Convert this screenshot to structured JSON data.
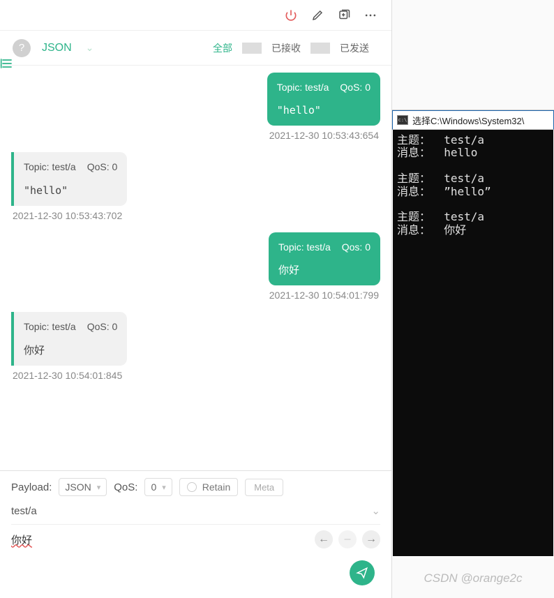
{
  "toolbar": {
    "format": "JSON",
    "filters": {
      "all": "全部",
      "received": "已接收",
      "sent": "已发送"
    }
  },
  "messages": [
    {
      "dir": "sent",
      "topic_lbl": "Topic:",
      "topic": "test/a",
      "qos_lbl": "QoS:",
      "qos": "0",
      "body": "\"hello\"",
      "ts": "2021-12-30 10:53:43:654"
    },
    {
      "dir": "rcvd",
      "topic_lbl": "Topic:",
      "topic": "test/a",
      "qos_lbl": "QoS:",
      "qos": "0",
      "body": "\"hello\"",
      "ts": "2021-12-30 10:53:43:702"
    },
    {
      "dir": "sent",
      "topic_lbl": "Topic:",
      "topic": "test/a",
      "qos_lbl": "Qos:",
      "qos": "0",
      "body": "你好",
      "ts": "2021-12-30 10:54:01:799"
    },
    {
      "dir": "rcvd",
      "topic_lbl": "Topic:",
      "topic": "test/a",
      "qos_lbl": "QoS:",
      "qos": "0",
      "body": "你好",
      "ts": "2021-12-30 10:54:01:845"
    }
  ],
  "compose": {
    "payload_lbl": "Payload:",
    "payload_format": "JSON",
    "qos_lbl": "QoS:",
    "qos_val": "0",
    "retain_lbl": "Retain",
    "meta_lbl": "Meta",
    "topic": "test/a",
    "body": "你好"
  },
  "terminal": {
    "title": "选择C:\\Windows\\System32\\",
    "lines": "主题：  test/a\n消息：  hello\n\n主题：  test/a\n消息：  ”hello”\n\n主题：  test/a\n消息：  你好"
  },
  "watermark": "CSDN @orange2c"
}
